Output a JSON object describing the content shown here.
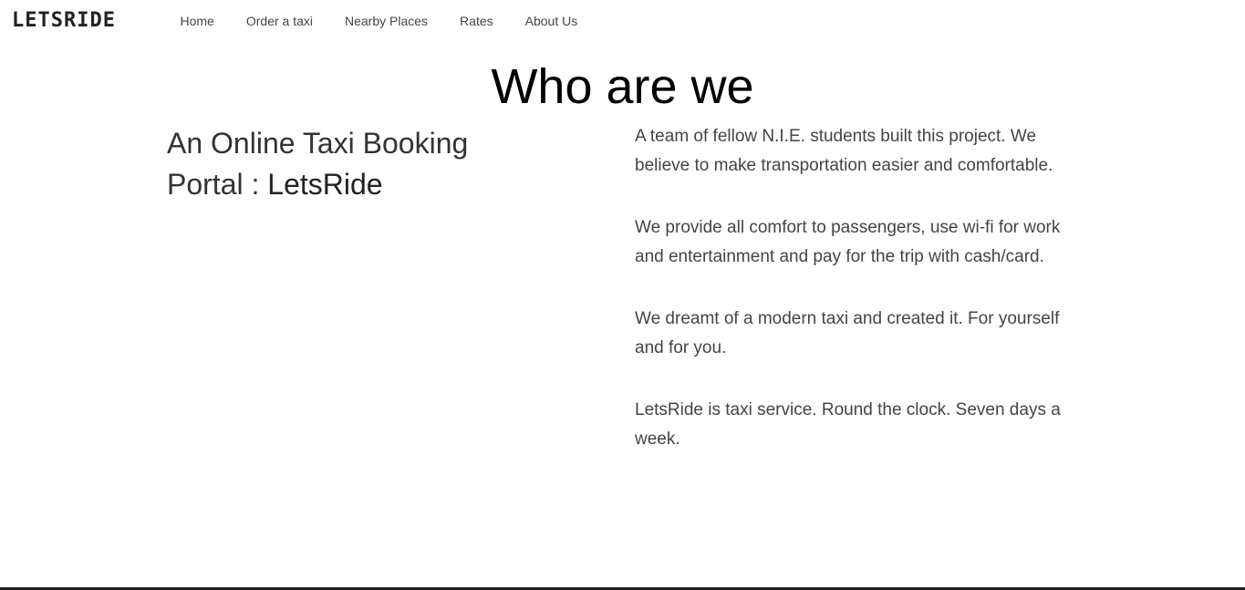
{
  "nav": {
    "brand": "LETSRIDE",
    "links": [
      "Home",
      "Order a taxi",
      "Nearby Places",
      "Rates",
      "About Us"
    ]
  },
  "main": {
    "title": "Who are we",
    "subtitle_prefix": "An Online Taxi Booking Portal : ",
    "subtitle_brand": "LetsRide",
    "paragraphs": [
      "A team of fellow N.I.E. students built this project. We believe to make transportation easier and comfortable.",
      "We provide all comfort to passengers, use wi-fi for work and entertainment and pay for the trip with cash/card.",
      "We dreamt of a modern taxi and created it. For yourself and for you.",
      "LetsRide is taxi service. Round the clock. Seven days a week."
    ]
  }
}
